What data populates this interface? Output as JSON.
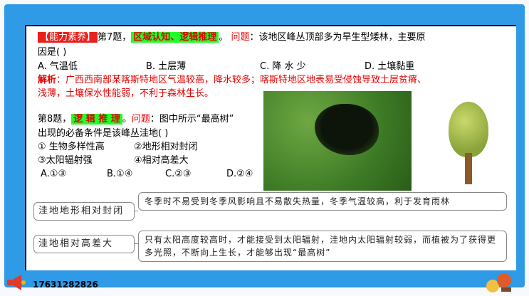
{
  "q7": {
    "tag": "【能力素养】",
    "num": "第7题，",
    "skill": "区域认知、逻辑推理",
    "dot": "。",
    "ask_label": "问题",
    "ask_text": "：该地区峰丛顶部多为旱生型矮林，主要原",
    "line2": "因是(     )",
    "options": [
      "A. 气温低",
      "B. 土层薄",
      "C. 降 水 少",
      "D. 土壤黏重"
    ],
    "analysis_label": "解析",
    "analysis_line1": "：广西西南部某喀斯特地区气温较高，降水较多；喀斯特地区地表易受侵蚀导致土层贫瘠、",
    "analysis_line2": "浅薄，土壤保水性能弱，不利于森林生长。"
  },
  "q8": {
    "num": "第8题，",
    "skill": "逻 辑 推 理",
    "dot": "。",
    "ask_label": "问题",
    "ask_text": "：图中所示“最高树”",
    "line2": "出现的必备条件是该峰丛洼地(       )",
    "cond1": "① 生物多样性高",
    "cond2": "②地形相对封闭",
    "cond3": "③太阳辐射强",
    "cond4": "④相对高差大",
    "options": [
      "A.①③",
      "B.①④",
      "C.②③",
      "D.②④"
    ]
  },
  "boxes": [
    {
      "label": "洼地地形相对封闭",
      "text": "冬季时不易受到冬季风影响且不易散失热量，冬季气温较高，利于发育雨林"
    },
    {
      "label": "洼地相对高差大",
      "text": "只有太阳高度较高时，才能接受到太阳辐射，洼地内太阳辐射较弱，而植被为了获得更多光照，不断向上生长，才能够出现“最高树”"
    }
  ],
  "phone": "17631282826",
  "icons": [
    "horn-icon",
    "decoration-icon"
  ],
  "colors": {
    "frame": "#2f9ae6",
    "tag_red": "#e8211d",
    "tag_green": "#1fff2a",
    "accent_red": "#e60000"
  }
}
